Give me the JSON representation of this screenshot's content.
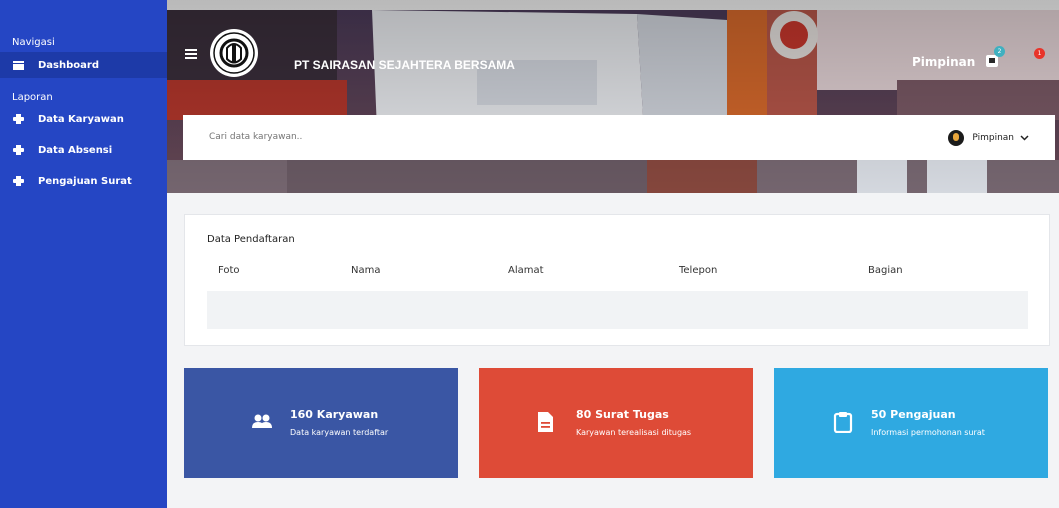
{
  "sidebar": {
    "section_navigation": "Navigasi",
    "section_reports": "Laporan",
    "items": [
      {
        "label": "Dashboard",
        "icon": "dashboard-icon",
        "active": true
      },
      {
        "label": "Data Karyawan",
        "icon": "print-icon"
      },
      {
        "label": "Data Absensi",
        "icon": "print-icon"
      },
      {
        "label": "Pengajuan Surat",
        "icon": "print-icon"
      }
    ]
  },
  "header": {
    "company": "PT SAIRASAN SEJAHTERA BERSAMA",
    "role": "Pimpinan",
    "notification_count": "2",
    "alert_count": "1"
  },
  "search": {
    "placeholder": "Cari data karyawan.."
  },
  "user": {
    "name": "Pimpinan"
  },
  "registration": {
    "title": "Data Pendaftaran",
    "columns": [
      "Foto",
      "Nama",
      "Alamat",
      "Telepon",
      "Bagian"
    ]
  },
  "cards": [
    {
      "title": "160 Karyawan",
      "subtitle": "Data karyawan terdaftar",
      "icon": "users-icon",
      "color": "#3a56a4"
    },
    {
      "title": "80 Surat Tugas",
      "subtitle": "Karyawan terealisasi ditugas",
      "icon": "document-icon",
      "color": "#de4b37"
    },
    {
      "title": "50 Pengajuan",
      "subtitle": "Informasi permohonan surat",
      "icon": "clipboard-icon",
      "color": "#2fa9e1"
    }
  ],
  "colors": {
    "sidebar": "#2546c4",
    "sidebar_active": "#1d3aa8",
    "background": "#f3f4f6"
  }
}
